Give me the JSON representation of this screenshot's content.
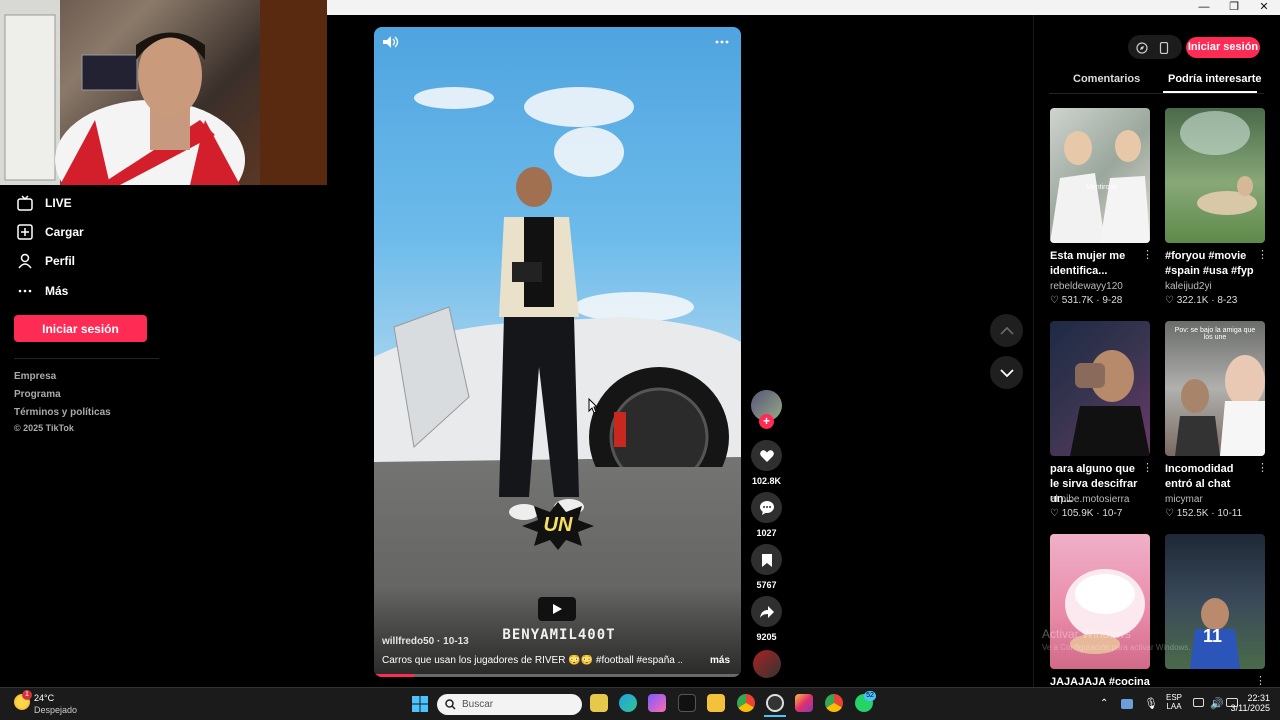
{
  "window": {
    "minimize": "—",
    "maximize": "❐",
    "close": "✕"
  },
  "nav": {
    "items": [
      {
        "label": "LIVE",
        "icon": "live-tv-icon"
      },
      {
        "label": "Cargar",
        "icon": "upload-plus-icon"
      },
      {
        "label": "Perfil",
        "icon": "profile-person-icon"
      },
      {
        "label": "Más",
        "icon": "more-dots-icon"
      }
    ],
    "login_label": "Iniciar sesión",
    "footer": [
      "Empresa",
      "Programa",
      "Términos y políticas"
    ],
    "copyright": "© 2025 TikTok"
  },
  "video": {
    "author": "willfredo50",
    "date": "10-13",
    "caption": "Carros que usan los jugadores de RIVER 😳😳 #football #españa ...",
    "more_label": "más",
    "sticker_text": "UN",
    "watermark": "BENYAMIL400T",
    "progress": 0.11
  },
  "actions": {
    "likes": "102.8K",
    "comments": "1027",
    "saves": "5767",
    "shares": "9205"
  },
  "header_right": {
    "login_label": "Iniciar sesión"
  },
  "tabs": [
    "Comentarios",
    "Podría interesarte"
  ],
  "cards": [
    {
      "title": "Esta mujer me identifica...",
      "user": "rebeldewayy120",
      "likes": "531.7K",
      "date": "9-28",
      "overlay": "Mentiroso"
    },
    {
      "title": "#foryou #movie #spain #usa #fyp",
      "user": "kaleijud2yi",
      "likes": "322.1K",
      "date": "8-23",
      "overlay": ""
    },
    {
      "title": "para alguno que le sirva descifrar un...",
      "user": "el.pibe.motosierra",
      "likes": "105.9K",
      "date": "10-7",
      "overlay": ""
    },
    {
      "title": "Incomodidad entró al chat",
      "user": "micymar",
      "likes": "152.5K",
      "date": "10-11",
      "overlay": "Pov: se bajo la amiga que los une"
    },
    {
      "title": "JAJAJAJA #cocina",
      "user": "",
      "likes": "",
      "date": "",
      "overlay": ""
    },
    {
      "title": "",
      "user": "",
      "likes": "",
      "date": "",
      "overlay": "11"
    }
  ],
  "activate_windows": "Activar Windows",
  "activate_sub": "Ve a Configuración para activar Windows.",
  "taskbar": {
    "weather_temp": "24°C",
    "weather_desc": "Despejado",
    "weather_badge": "1",
    "search_placeholder": "Buscar",
    "whatsapp_badge": "52",
    "lang_top": "ESP",
    "lang_bottom": "LAA",
    "time": "22:31",
    "date": "3/11/2025"
  },
  "colors": {
    "accent": "#fe2c55",
    "panel": "#000000",
    "taskbar": "#1b1b1b"
  }
}
